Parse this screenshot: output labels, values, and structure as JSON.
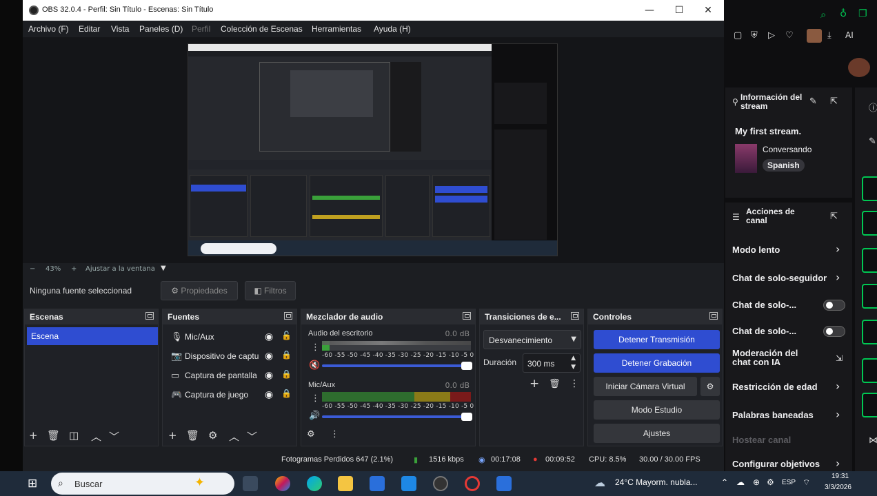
{
  "window": {
    "title": "OBS 32.0.4 - Perfil: Sin Título - Escenas: Sin Título",
    "minimize_glyph": "—",
    "maximize_glyph": "☐",
    "close_glyph": "✕"
  },
  "menu": {
    "archivo": "Archivo (F)",
    "editar": "Editar",
    "vista": "Vista",
    "paneles": "Paneles (D)",
    "perfil": "Perfil",
    "coleccion": "Colección de Escenas",
    "herramientas": "Herramientas",
    "ayuda": "Ayuda (H)"
  },
  "zoom": {
    "minus": "−",
    "value": "43%",
    "plus": "+",
    "fit": "Ajustar a la ventana"
  },
  "source_bar": {
    "label": "Ninguna fuente seleccionad",
    "properties": "Propiedades",
    "filters": "Filtros"
  },
  "scenes": {
    "title": "Escenas",
    "items": [
      "Escena"
    ]
  },
  "sources": {
    "title": "Fuentes",
    "items": [
      {
        "name": "Mic/Aux",
        "icon": "microphone-icon"
      },
      {
        "name": "Dispositivo de captu",
        "icon": "camera-icon"
      },
      {
        "name": "Captura de pantalla",
        "icon": "monitor-icon"
      },
      {
        "name": "Captura de juego",
        "icon": "gamepad-icon"
      }
    ]
  },
  "mixer": {
    "title": "Mezclador de audio",
    "channels": [
      {
        "name": "Audio del escritorio",
        "db": "0.0 dB",
        "level": 0.05,
        "muted": true
      },
      {
        "name": "Mic/Aux",
        "db": "0.0 dB",
        "level": 0.0,
        "muted": false
      }
    ],
    "ticks": "-60 -55 -50 -45 -40 -35 -30 -25 -20 -15 -10  -5   0"
  },
  "transitions": {
    "title": "Transiciones de e...",
    "selected": "Desvanecimiento",
    "duration_label": "Duración",
    "duration_value": "300 ms"
  },
  "controls": {
    "title": "Controles",
    "stop_stream": "Detener Transmisión",
    "stop_record": "Detener Grabación",
    "virtual_cam": "Iniciar Cámara Virtual",
    "studio_mode": "Modo Estudio",
    "settings": "Ajustes"
  },
  "status": {
    "dropped": "Fotogramas Perdidos 647 (2.1%)",
    "bitrate": "1516 kbps",
    "stream_time": "00:17:08",
    "rec_time": "00:09:52",
    "cpu": "CPU: 8.5%",
    "fps": "30.00 / 30.00 FPS"
  },
  "side": {
    "stream_info_title": "Información del stream",
    "stream_title": "My first stream.",
    "category": "Conversando",
    "tag": "Spanish",
    "actions_title": "Acciones de canal",
    "actions": [
      {
        "label": "Modo lento",
        "kind": "chevron"
      },
      {
        "label": "Chat de solo-seguidor",
        "kind": "chevron"
      },
      {
        "label": "Chat de solo-...",
        "kind": "toggle"
      },
      {
        "label": "Chat de solo-...",
        "kind": "toggle"
      },
      {
        "label": "Moderación del chat con IA",
        "kind": "external"
      },
      {
        "label": "Restricción de edad",
        "kind": "chevron"
      },
      {
        "label": "Palabras baneadas",
        "kind": "chevron"
      },
      {
        "label": "Hostear canal",
        "kind": "disabled"
      },
      {
        "label": "Configurar objetivos",
        "kind": "chevron"
      }
    ],
    "ai_label": "AI"
  },
  "taskbar": {
    "search": "Buscar",
    "weather": "24°C  Mayorm. nubla...",
    "lang": "ESP",
    "time": "19:31",
    "date": "3/3/2026"
  },
  "colors": {
    "accent": "#2f4dd1",
    "record": "#e53935",
    "twitch_green": "#00c853"
  }
}
